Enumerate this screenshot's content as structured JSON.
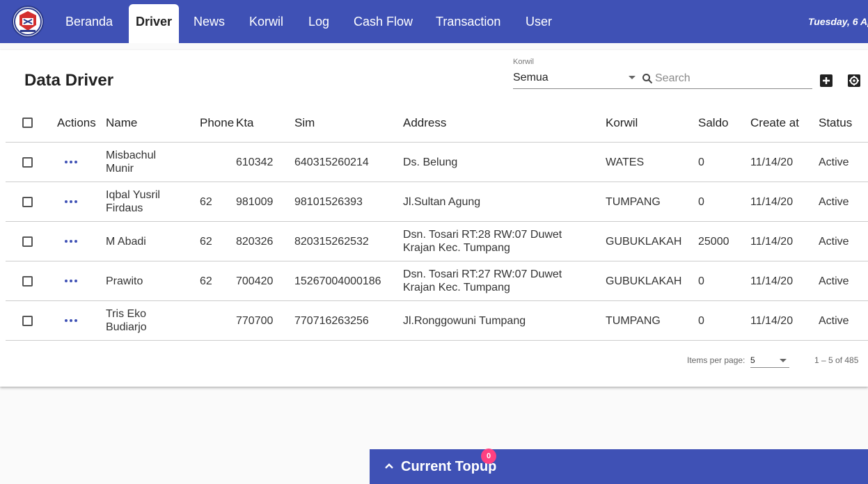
{
  "nav": {
    "items": [
      {
        "label": "Beranda",
        "active": false
      },
      {
        "label": "Driver",
        "active": true
      },
      {
        "label": "News",
        "active": false
      },
      {
        "label": "Korwil",
        "active": false
      },
      {
        "label": "Log",
        "active": false
      },
      {
        "label": "Cash Flow",
        "active": false
      },
      {
        "label": "Transaction",
        "active": false
      },
      {
        "label": "User",
        "active": false
      }
    ],
    "date": "Tuesday, 6 Ap"
  },
  "page": {
    "title": "Data Driver",
    "korwil_filter": {
      "label": "Korwil",
      "value": "Semua"
    },
    "search": {
      "placeholder": "Search",
      "value": ""
    }
  },
  "table": {
    "columns": [
      "Actions",
      "Name",
      "Phone",
      "Kta",
      "Sim",
      "Address",
      "Korwil",
      "Saldo",
      "Create at",
      "Status"
    ],
    "rows": [
      {
        "name": "Misbachul Munir",
        "phone": "",
        "kta": "610342",
        "sim": "640315260214",
        "address": "Ds. Belung",
        "korwil": "WATES",
        "saldo": "0",
        "created": "11/14/20",
        "status": "Active"
      },
      {
        "name": "Iqbal Yusril Firdaus",
        "phone": "62",
        "kta": "981009",
        "sim": "98101526393",
        "address": "Jl.Sultan Agung",
        "korwil": "TUMPANG",
        "saldo": "0",
        "created": "11/14/20",
        "status": "Active"
      },
      {
        "name": "M Abadi",
        "phone": "62",
        "kta": "820326",
        "sim": "820315262532",
        "address": "Dsn. Tosari RT:28 RW:07 Duwet Krajan Kec. Tumpang",
        "korwil": "GUBUKLAKAH",
        "saldo": "25000",
        "created": "11/14/20",
        "status": "Active"
      },
      {
        "name": "Prawito",
        "phone": "62",
        "kta": "700420",
        "sim": "15267004000186",
        "address": "Dsn. Tosari RT:27 RW:07 Duwet Krajan Kec. Tumpang",
        "korwil": "GUBUKLAKAH",
        "saldo": "0",
        "created": "11/14/20",
        "status": "Active"
      },
      {
        "name": "Tris Eko Budiarjo",
        "phone": "",
        "kta": "770700",
        "sim": "770716263256",
        "address": "Jl.Ronggowuni Tumpang",
        "korwil": "TUMPANG",
        "saldo": "0",
        "created": "11/14/20",
        "status": "Active"
      }
    ]
  },
  "paginator": {
    "items_per_page_label": "Items per page:",
    "page_size": "5",
    "range": "1 – 5 of 485"
  },
  "topup": {
    "label": "Current Topup",
    "badge": "0"
  },
  "colors": {
    "primary": "#3f51b5",
    "badge": "#ff4081"
  }
}
